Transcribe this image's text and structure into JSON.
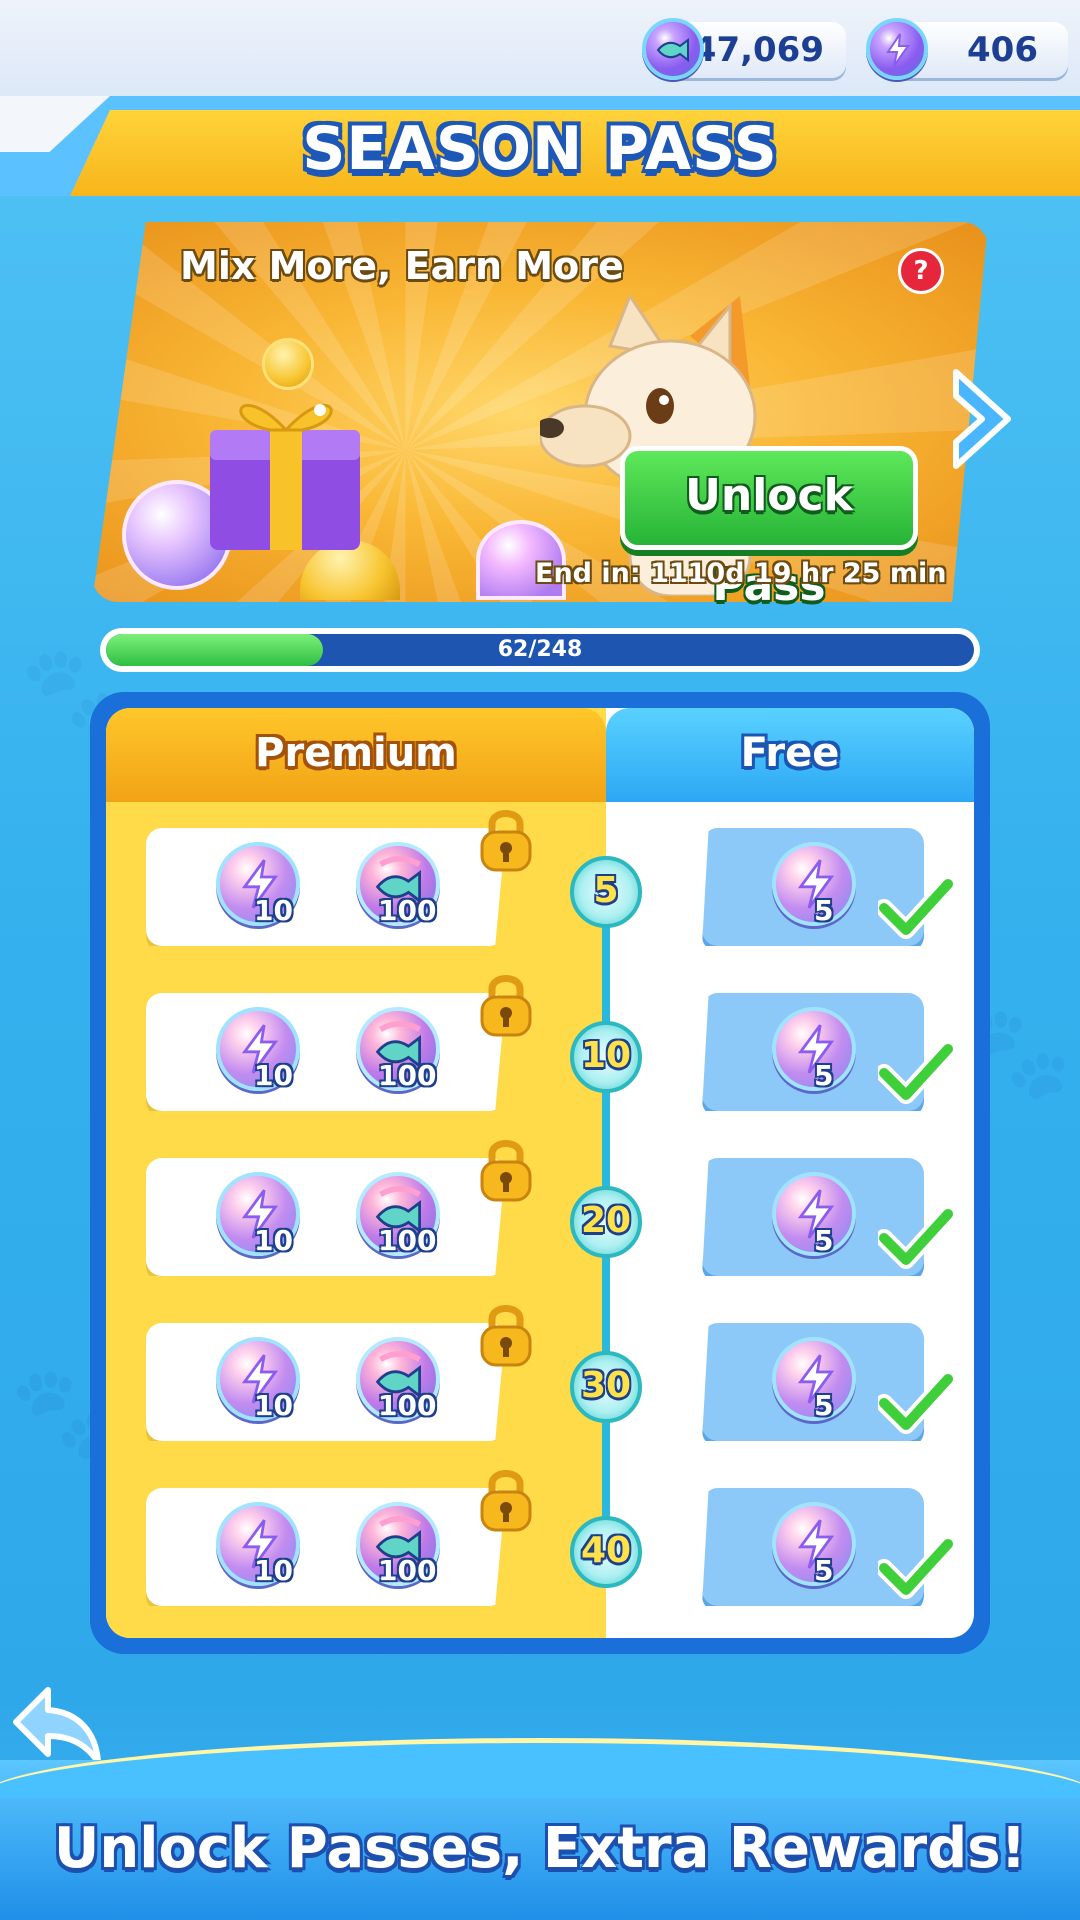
{
  "currencies": [
    {
      "icon": "fish-coin-icon",
      "value": "347,069"
    },
    {
      "icon": "energy-coin-icon",
      "value": "406"
    }
  ],
  "header": {
    "title": "SEASON PASS"
  },
  "banner": {
    "title": "Mix More, Earn More",
    "help_label": "?",
    "unlock_label": "Unlock Pass",
    "end_text": "End in: 1110d 19 hr 25 min"
  },
  "progress": {
    "label": "62/248",
    "current": 62,
    "total": 248
  },
  "columns": {
    "premium": "Premium",
    "free": "Free"
  },
  "tiers": [
    {
      "level": "5",
      "premium": [
        {
          "type": "energy",
          "qty": "10"
        },
        {
          "type": "fish",
          "qty": "100"
        }
      ],
      "free": {
        "type": "energy",
        "qty": "5"
      },
      "premium_locked": true,
      "free_claimed": true
    },
    {
      "level": "10",
      "premium": [
        {
          "type": "energy",
          "qty": "10"
        },
        {
          "type": "fish",
          "qty": "100"
        }
      ],
      "free": {
        "type": "energy",
        "qty": "5"
      },
      "premium_locked": true,
      "free_claimed": true
    },
    {
      "level": "20",
      "premium": [
        {
          "type": "energy",
          "qty": "10"
        },
        {
          "type": "fish",
          "qty": "100"
        }
      ],
      "free": {
        "type": "energy",
        "qty": "5"
      },
      "premium_locked": true,
      "free_claimed": true
    },
    {
      "level": "30",
      "premium": [
        {
          "type": "energy",
          "qty": "10"
        },
        {
          "type": "fish",
          "qty": "100"
        }
      ],
      "free": {
        "type": "energy",
        "qty": "5"
      },
      "premium_locked": true,
      "free_claimed": true
    },
    {
      "level": "40",
      "premium": [
        {
          "type": "energy",
          "qty": "10"
        },
        {
          "type": "fish",
          "qty": "100"
        }
      ],
      "free": {
        "type": "energy",
        "qty": "5"
      },
      "premium_locked": true,
      "free_claimed": true
    }
  ],
  "footer": {
    "text": "Unlock Passes, Extra Rewards!"
  },
  "colors": {
    "premium": "#ffdb4a",
    "free": "#2ca8f4",
    "accent_green": "#27b437",
    "dark_blue": "#1d55b0"
  }
}
